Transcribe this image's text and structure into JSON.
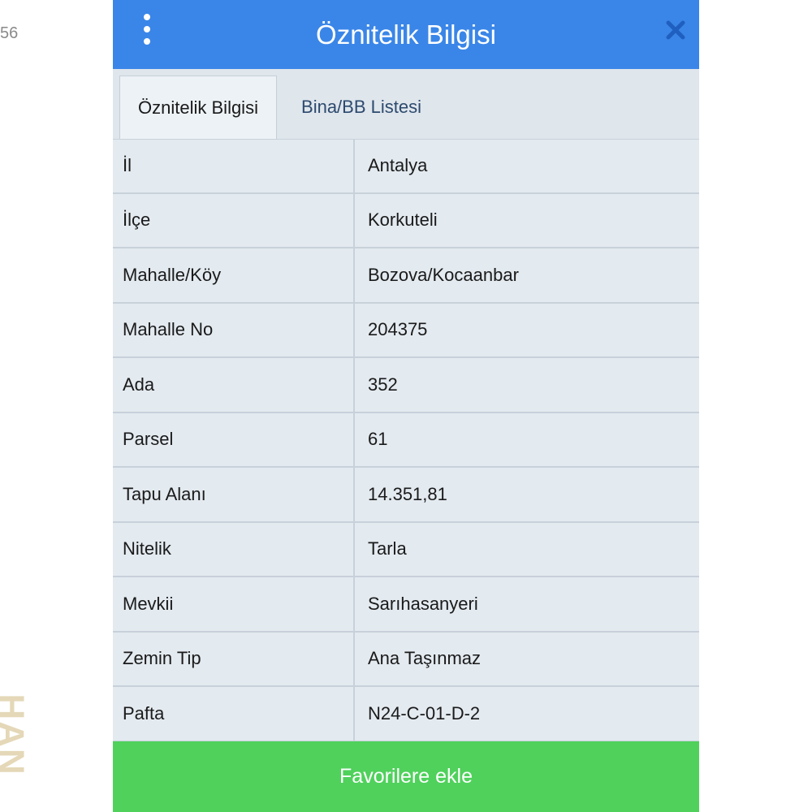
{
  "background": {
    "corner_text": "56",
    "side_text": "HAN"
  },
  "header": {
    "title": "Öznitelik Bilgisi",
    "menu_icon": "vertical-dots-icon",
    "close_icon": "close-icon",
    "color": "#3a86e8"
  },
  "tabs": [
    {
      "label": "Öznitelik Bilgisi",
      "active": true
    },
    {
      "label": "Bina/BB Listesi",
      "active": false
    }
  ],
  "attributes": [
    {
      "label": "İl",
      "value": "Antalya"
    },
    {
      "label": "İlçe",
      "value": "Korkuteli"
    },
    {
      "label": "Mahalle/Köy",
      "value": "Bozova/Kocaanbar"
    },
    {
      "label": "Mahalle No",
      "value": "204375"
    },
    {
      "label": "Ada",
      "value": "352"
    },
    {
      "label": "Parsel",
      "value": "61"
    },
    {
      "label": "Tapu Alanı",
      "value": "14.351,81"
    },
    {
      "label": "Nitelik",
      "value": "Tarla"
    },
    {
      "label": "Mevkii",
      "value": "Sarıhasanyeri"
    },
    {
      "label": "Zemin Tip",
      "value": "Ana Taşınmaz"
    },
    {
      "label": "Pafta",
      "value": "N24-C-01-D-2"
    }
  ],
  "footer": {
    "button_label": "Favorilere ekle",
    "button_color": "#4fd15c"
  }
}
